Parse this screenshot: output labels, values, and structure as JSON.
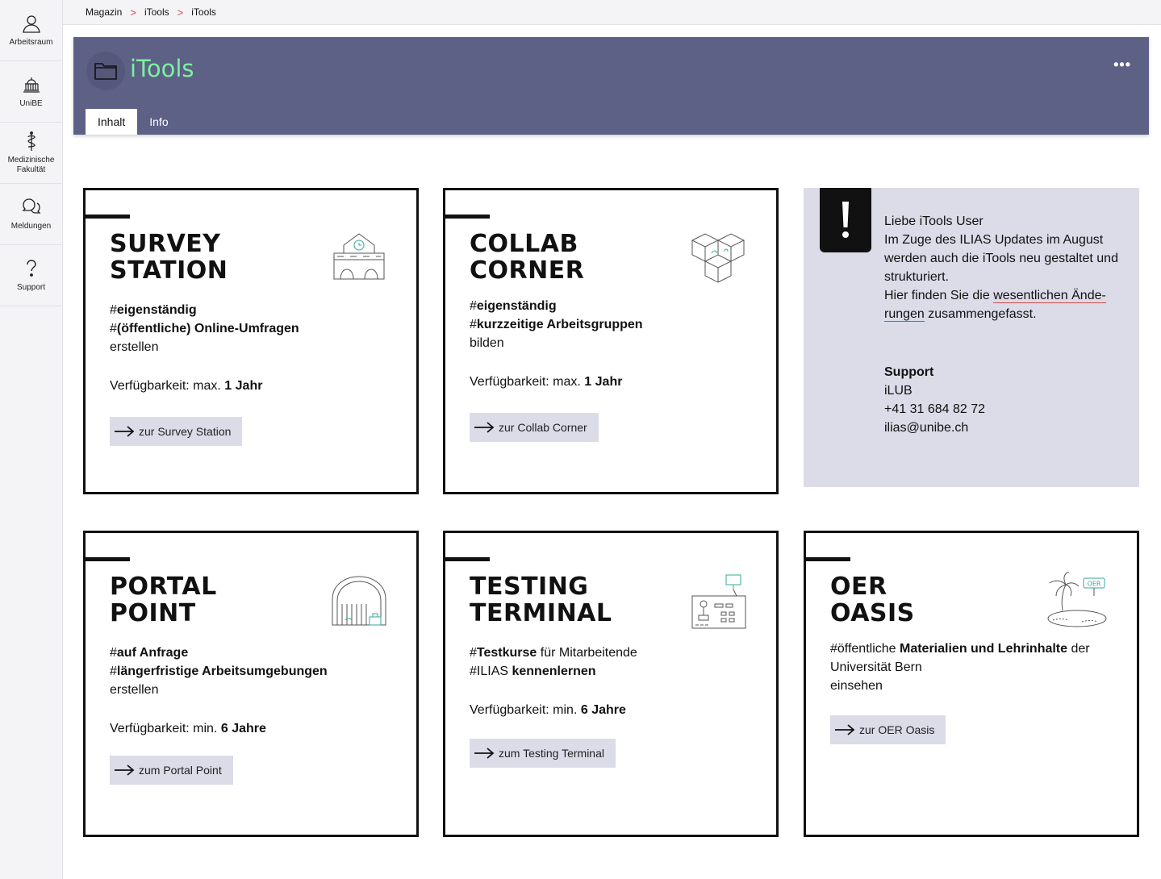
{
  "sidebar": {
    "items": [
      {
        "label": "Arbeitsraum",
        "icon": "user-icon"
      },
      {
        "label": "UniBE",
        "icon": "building-icon"
      },
      {
        "label": "Medizinische Fakultät",
        "icon": "caduceus-icon"
      },
      {
        "label": "Meldungen",
        "icon": "chat-bubbles-icon"
      },
      {
        "label": "Support",
        "icon": "question-icon"
      }
    ]
  },
  "breadcrumb": [
    "Magazin",
    "iTools",
    "iTools"
  ],
  "header": {
    "title": "iTools",
    "more": "•••",
    "tabs": [
      "Inhalt",
      "Info"
    ]
  },
  "cards": {
    "survey": {
      "title1": "SURVEY",
      "title2": "STATION",
      "d1_pre": "#",
      "d1_bold": "eigenständig",
      "d2_pre": "#",
      "d2_bold": "(öffentliche) Online-Umfragen",
      "d3": "erstellen",
      "avail_pre": "Verfügbarkeit: max. ",
      "avail_bold": "1 Jahr",
      "button": "zur Survey Station"
    },
    "collab": {
      "title1": "COLLAB",
      "title2": "CORNER",
      "d1_pre": "#",
      "d1_bold": "eigenständig",
      "d2_pre": "#",
      "d2_bold": "kurzzeitige Arbeitsgruppen",
      "d3": "bilden",
      "avail_pre": "Verfügbarkeit: max. ",
      "avail_bold": "1 Jahr",
      "button": "zur Collab Corner"
    },
    "portal": {
      "title1": "PORTAL",
      "title2": "POINT",
      "d1_pre": "#",
      "d1_bold": "auf Anfrage",
      "d2_pre": "#",
      "d2_bold": "längerfristige Arbeitsumgebungen",
      "d3": "erstellen",
      "avail_pre": "Verfügbarkeit: min. ",
      "avail_bold": "6 Jahre",
      "button": "zum Portal Point"
    },
    "testing": {
      "title1": "TESTING",
      "title2": "TERMINAL",
      "d1_pre": "#",
      "d1_bold": "Testkurse",
      "d1_post": " für Mitarbeitende",
      "d2_pre": "#ILIAS ",
      "d2_bold": "kennenlernen",
      "avail_pre": "Verfügbarkeit: min. ",
      "avail_bold": "6 Jahre",
      "button": "zum Testing Terminal"
    },
    "oer": {
      "title1": "OER",
      "title2": "OASIS",
      "d1_pre": "#öffentliche ",
      "d1_bold": "Materialien und Lehrinhalte",
      "d1_post": " der",
      "d2": "Universität Bern",
      "d3": "einsehen",
      "button": "zur OER Oasis",
      "illus_label": "OER"
    }
  },
  "notice": {
    "badge": "!",
    "l1": "Liebe iTools User",
    "l2": "Im Zuge des ILIAS Updates im August werden auch die iTools neu gestaltet und strukturiert.",
    "l3_pre": "Hier finden Sie die ",
    "l3_link1": "wesentlichen Ände-",
    "l3_link2": "rungen",
    "l3_post": " zusammengefasst.",
    "support_title": "Support",
    "support_org": "iLUB",
    "support_phone": "+41 31 684 82 72",
    "support_email": "ilias@unibe.ch"
  }
}
